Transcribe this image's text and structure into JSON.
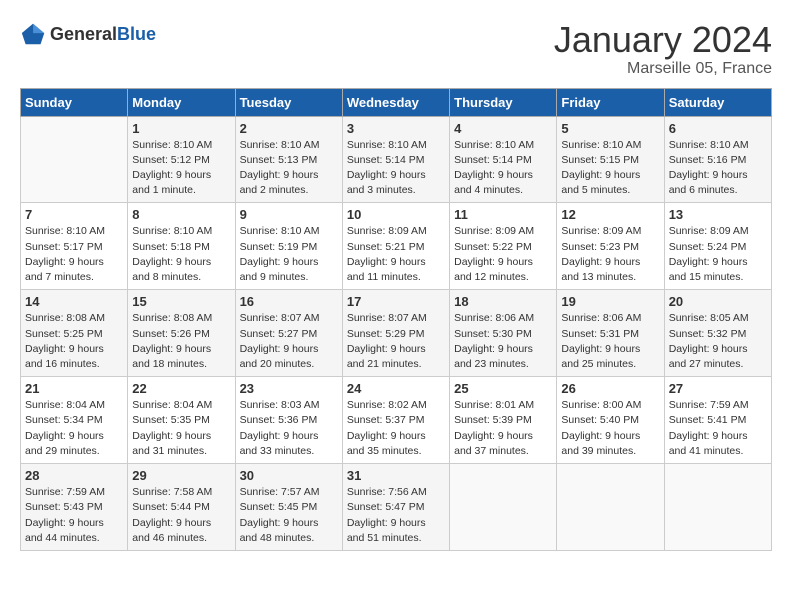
{
  "header": {
    "logo_general": "General",
    "logo_blue": "Blue",
    "title": "January 2024",
    "subtitle": "Marseille 05, France"
  },
  "days_of_week": [
    "Sunday",
    "Monday",
    "Tuesday",
    "Wednesday",
    "Thursday",
    "Friday",
    "Saturday"
  ],
  "weeks": [
    [
      {
        "day": "",
        "sunrise": "",
        "sunset": "",
        "daylight": ""
      },
      {
        "day": "1",
        "sunrise": "Sunrise: 8:10 AM",
        "sunset": "Sunset: 5:12 PM",
        "daylight": "Daylight: 9 hours and 1 minute."
      },
      {
        "day": "2",
        "sunrise": "Sunrise: 8:10 AM",
        "sunset": "Sunset: 5:13 PM",
        "daylight": "Daylight: 9 hours and 2 minutes."
      },
      {
        "day": "3",
        "sunrise": "Sunrise: 8:10 AM",
        "sunset": "Sunset: 5:14 PM",
        "daylight": "Daylight: 9 hours and 3 minutes."
      },
      {
        "day": "4",
        "sunrise": "Sunrise: 8:10 AM",
        "sunset": "Sunset: 5:14 PM",
        "daylight": "Daylight: 9 hours and 4 minutes."
      },
      {
        "day": "5",
        "sunrise": "Sunrise: 8:10 AM",
        "sunset": "Sunset: 5:15 PM",
        "daylight": "Daylight: 9 hours and 5 minutes."
      },
      {
        "day": "6",
        "sunrise": "Sunrise: 8:10 AM",
        "sunset": "Sunset: 5:16 PM",
        "daylight": "Daylight: 9 hours and 6 minutes."
      }
    ],
    [
      {
        "day": "7",
        "sunrise": "Sunrise: 8:10 AM",
        "sunset": "Sunset: 5:17 PM",
        "daylight": "Daylight: 9 hours and 7 minutes."
      },
      {
        "day": "8",
        "sunrise": "Sunrise: 8:10 AM",
        "sunset": "Sunset: 5:18 PM",
        "daylight": "Daylight: 9 hours and 8 minutes."
      },
      {
        "day": "9",
        "sunrise": "Sunrise: 8:10 AM",
        "sunset": "Sunset: 5:19 PM",
        "daylight": "Daylight: 9 hours and 9 minutes."
      },
      {
        "day": "10",
        "sunrise": "Sunrise: 8:09 AM",
        "sunset": "Sunset: 5:21 PM",
        "daylight": "Daylight: 9 hours and 11 minutes."
      },
      {
        "day": "11",
        "sunrise": "Sunrise: 8:09 AM",
        "sunset": "Sunset: 5:22 PM",
        "daylight": "Daylight: 9 hours and 12 minutes."
      },
      {
        "day": "12",
        "sunrise": "Sunrise: 8:09 AM",
        "sunset": "Sunset: 5:23 PM",
        "daylight": "Daylight: 9 hours and 13 minutes."
      },
      {
        "day": "13",
        "sunrise": "Sunrise: 8:09 AM",
        "sunset": "Sunset: 5:24 PM",
        "daylight": "Daylight: 9 hours and 15 minutes."
      }
    ],
    [
      {
        "day": "14",
        "sunrise": "Sunrise: 8:08 AM",
        "sunset": "Sunset: 5:25 PM",
        "daylight": "Daylight: 9 hours and 16 minutes."
      },
      {
        "day": "15",
        "sunrise": "Sunrise: 8:08 AM",
        "sunset": "Sunset: 5:26 PM",
        "daylight": "Daylight: 9 hours and 18 minutes."
      },
      {
        "day": "16",
        "sunrise": "Sunrise: 8:07 AM",
        "sunset": "Sunset: 5:27 PM",
        "daylight": "Daylight: 9 hours and 20 minutes."
      },
      {
        "day": "17",
        "sunrise": "Sunrise: 8:07 AM",
        "sunset": "Sunset: 5:29 PM",
        "daylight": "Daylight: 9 hours and 21 minutes."
      },
      {
        "day": "18",
        "sunrise": "Sunrise: 8:06 AM",
        "sunset": "Sunset: 5:30 PM",
        "daylight": "Daylight: 9 hours and 23 minutes."
      },
      {
        "day": "19",
        "sunrise": "Sunrise: 8:06 AM",
        "sunset": "Sunset: 5:31 PM",
        "daylight": "Daylight: 9 hours and 25 minutes."
      },
      {
        "day": "20",
        "sunrise": "Sunrise: 8:05 AM",
        "sunset": "Sunset: 5:32 PM",
        "daylight": "Daylight: 9 hours and 27 minutes."
      }
    ],
    [
      {
        "day": "21",
        "sunrise": "Sunrise: 8:04 AM",
        "sunset": "Sunset: 5:34 PM",
        "daylight": "Daylight: 9 hours and 29 minutes."
      },
      {
        "day": "22",
        "sunrise": "Sunrise: 8:04 AM",
        "sunset": "Sunset: 5:35 PM",
        "daylight": "Daylight: 9 hours and 31 minutes."
      },
      {
        "day": "23",
        "sunrise": "Sunrise: 8:03 AM",
        "sunset": "Sunset: 5:36 PM",
        "daylight": "Daylight: 9 hours and 33 minutes."
      },
      {
        "day": "24",
        "sunrise": "Sunrise: 8:02 AM",
        "sunset": "Sunset: 5:37 PM",
        "daylight": "Daylight: 9 hours and 35 minutes."
      },
      {
        "day": "25",
        "sunrise": "Sunrise: 8:01 AM",
        "sunset": "Sunset: 5:39 PM",
        "daylight": "Daylight: 9 hours and 37 minutes."
      },
      {
        "day": "26",
        "sunrise": "Sunrise: 8:00 AM",
        "sunset": "Sunset: 5:40 PM",
        "daylight": "Daylight: 9 hours and 39 minutes."
      },
      {
        "day": "27",
        "sunrise": "Sunrise: 7:59 AM",
        "sunset": "Sunset: 5:41 PM",
        "daylight": "Daylight: 9 hours and 41 minutes."
      }
    ],
    [
      {
        "day": "28",
        "sunrise": "Sunrise: 7:59 AM",
        "sunset": "Sunset: 5:43 PM",
        "daylight": "Daylight: 9 hours and 44 minutes."
      },
      {
        "day": "29",
        "sunrise": "Sunrise: 7:58 AM",
        "sunset": "Sunset: 5:44 PM",
        "daylight": "Daylight: 9 hours and 46 minutes."
      },
      {
        "day": "30",
        "sunrise": "Sunrise: 7:57 AM",
        "sunset": "Sunset: 5:45 PM",
        "daylight": "Daylight: 9 hours and 48 minutes."
      },
      {
        "day": "31",
        "sunrise": "Sunrise: 7:56 AM",
        "sunset": "Sunset: 5:47 PM",
        "daylight": "Daylight: 9 hours and 51 minutes."
      },
      {
        "day": "",
        "sunrise": "",
        "sunset": "",
        "daylight": ""
      },
      {
        "day": "",
        "sunrise": "",
        "sunset": "",
        "daylight": ""
      },
      {
        "day": "",
        "sunrise": "",
        "sunset": "",
        "daylight": ""
      }
    ]
  ]
}
